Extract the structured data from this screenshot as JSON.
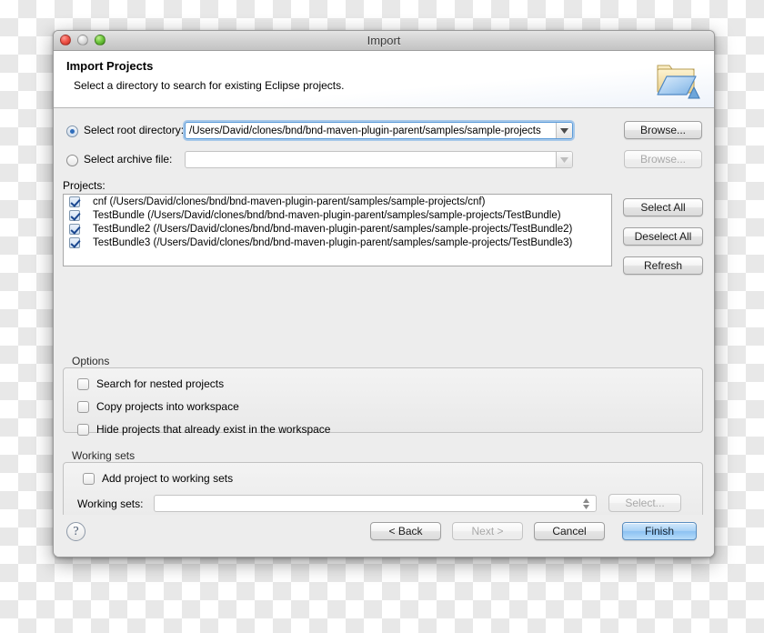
{
  "window": {
    "title": "Import",
    "controls": [
      "close",
      "minimize",
      "zoom"
    ]
  },
  "header": {
    "title": "Import Projects",
    "subtitle": "Select a directory to search for existing Eclipse projects.",
    "icon": "import-folder-icon"
  },
  "source": {
    "root_directory": {
      "label": "Select root directory:",
      "selected": true,
      "value": "/Users/David/clones/bnd/bnd-maven-plugin-parent/samples/sample-projects",
      "browse_label": "Browse..."
    },
    "archive_file": {
      "label": "Select archive file:",
      "selected": false,
      "value": "",
      "browse_label": "Browse...",
      "disabled": true
    }
  },
  "projects": {
    "label": "Projects:",
    "items": [
      {
        "checked": true,
        "name": "cnf",
        "path": "(/Users/David/clones/bnd/bnd-maven-plugin-parent/samples/sample-projects/cnf)"
      },
      {
        "checked": true,
        "name": "TestBundle",
        "path": "(/Users/David/clones/bnd/bnd-maven-plugin-parent/samples/sample-projects/TestBundle)"
      },
      {
        "checked": true,
        "name": "TestBundle2",
        "path": "(/Users/David/clones/bnd/bnd-maven-plugin-parent/samples/sample-projects/TestBundle2)"
      },
      {
        "checked": true,
        "name": "TestBundle3",
        "path": "(/Users/David/clones/bnd/bnd-maven-plugin-parent/samples/sample-projects/TestBundle3)"
      }
    ],
    "buttons": {
      "select_all": "Select All",
      "deselect_all": "Deselect All",
      "refresh": "Refresh"
    }
  },
  "options": {
    "title": "Options",
    "items": [
      {
        "label": "Search for nested projects",
        "checked": false
      },
      {
        "label": "Copy projects into workspace",
        "checked": false
      },
      {
        "label": "Hide projects that already exist in the workspace",
        "checked": false
      }
    ]
  },
  "working_sets": {
    "title": "Working sets",
    "add_checkbox": {
      "label": "Add project to working sets",
      "checked": false
    },
    "field_label": "Working sets:",
    "field_value": "",
    "select_label": "Select...",
    "select_disabled": true
  },
  "footer": {
    "help": "?",
    "back": "< Back",
    "next": "Next >",
    "next_disabled": true,
    "cancel": "Cancel",
    "finish": "Finish",
    "finish_default": true
  },
  "colors": {
    "accent": "#8cc2f2",
    "dialog_bg": "#ededed",
    "focus_ring": "#5a9ad8",
    "check_mark": "#19468f"
  }
}
